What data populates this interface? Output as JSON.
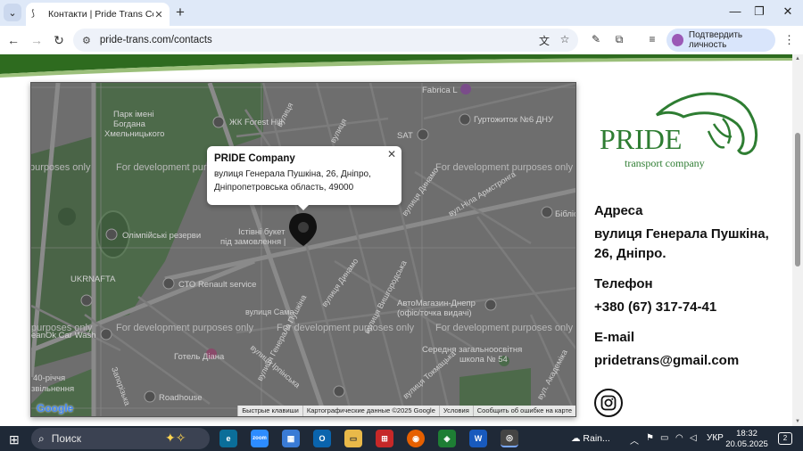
{
  "browser": {
    "tab_title": "Контакти | Pride Trans Compan",
    "url": "pride-trans.com/contacts",
    "verify_label": "Подтвердить личность"
  },
  "map": {
    "popup": {
      "name": "PRIDE Company",
      "address": "вулиця Генерала Пушкіна, 26, Дніпро, Дніпропетровська область, 49000"
    },
    "dev_watermark": "For development purposes only",
    "partial_watermark": "purposes only",
    "labels": {
      "park": "Парк імені Богдана Хмельницького",
      "forest_hill": "ЖК Forest Hill",
      "fabrica": "Fabrica L",
      "dorm": "Гуртожиток №6 ДНУ",
      "sat": "SAT",
      "armstronga": "вул.Ніла Армстронга",
      "biblio": "Бібліот",
      "olympic": "Олімпійські резерви",
      "dynamo1": "вулиця Динамо",
      "istini": "Істівні букет",
      "zamovlennya": "під замовлення |",
      "ukrnafta": "UKRNAFTA",
      "cto": "СТО Renault service",
      "pushkina": "вулиця Генерала Пушкіна",
      "dynamo2": "вулиця Динамо",
      "vyshgorodska": "вулиця Вишгородська",
      "avtomagazin": "АвтоМагазин-Днепр (офіс/точка видачі)",
      "carwash": "eanOk Car Wash",
      "gotel": "Готель Діана",
      "sama": "вулиця Сама",
      "irpinska": "вулиця Ірпінська",
      "tokmatska": "вулиця Токмацька",
      "school": "Середня загальноосвітня школа № 54",
      "akademika": "вул. Академіка",
      "zaporizhska": "Запорізька",
      "roadhouse": "Roadhouse",
      "anniv": "40-річчя",
      "zvilnennya": "звільнення",
      "vulytsya_top": "вулиця",
      "ravadska": "вулиця"
    },
    "attribution": [
      "Быстрые клавиши",
      "Картографические данные ©2025 Google",
      "Условия",
      "Сообщить об ошибке на карте"
    ],
    "google": "Google"
  },
  "logo": {
    "brand": "PRIDE",
    "tagline": "transport company",
    "color": "#2e7d32"
  },
  "contacts": {
    "address_label": "Адреса",
    "address_value": "вулиця Генерала Пушкіна, 26, Дніпро.",
    "phone_label": "Телефон",
    "phone_value": "+380 (67) 317-74-41",
    "email_label": "E-mail",
    "email_value": "pridetrans@gmail.com"
  },
  "taskbar": {
    "search": "Поиск",
    "weather": "Rain...",
    "lang": "УКР",
    "time": "18:32",
    "date": "20.05.2025",
    "notif_count": "2"
  }
}
